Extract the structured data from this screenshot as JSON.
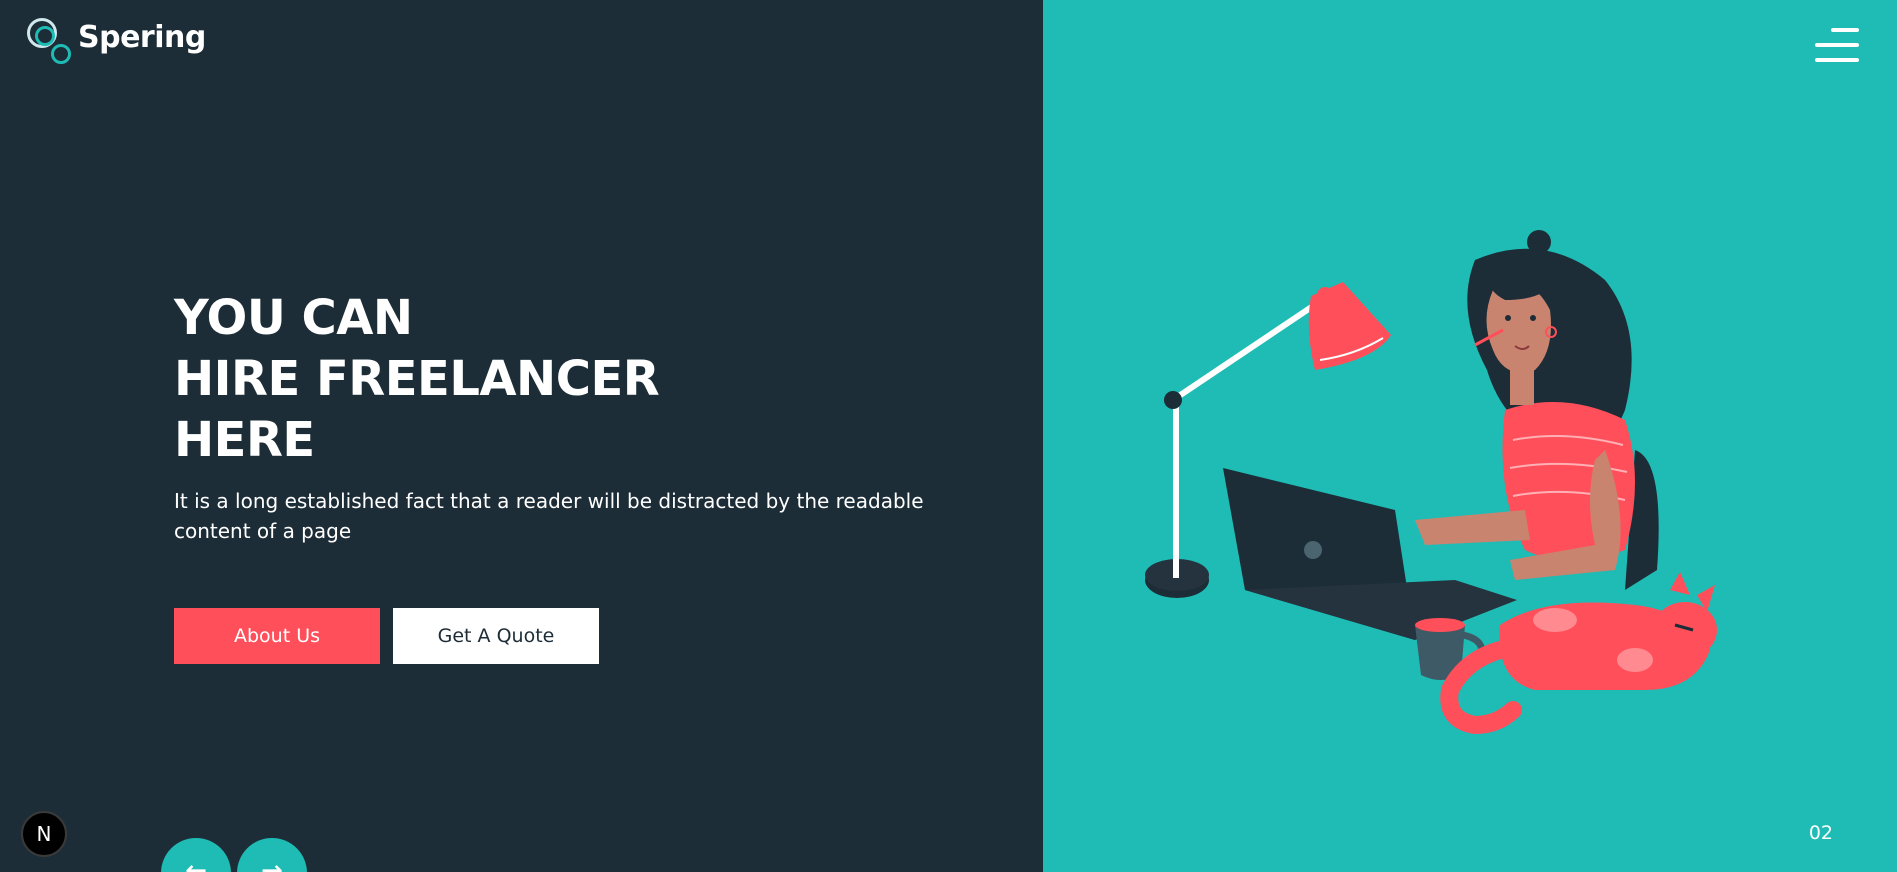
{
  "brand": {
    "name": "Spering"
  },
  "hero": {
    "title_lines": [
      "YOU CAN",
      "HIRE FREELANCER",
      "HERE"
    ],
    "description": "It is a long established fact that a reader will be distracted by the readable content of a page",
    "primary_button": "About Us",
    "secondary_button": "Get A Quote"
  },
  "slider": {
    "current": "02",
    "prev_icon": "arrow-left-icon",
    "next_icon": "arrow-right-icon"
  },
  "badge": {
    "label": "N"
  },
  "icons": {
    "menu": "hamburger-menu-icon",
    "logo": "logo-circles-icon"
  },
  "colors": {
    "dark": "#1d2d37",
    "teal": "#1ebcb5",
    "coral": "#ff4f5a",
    "white": "#ffffff"
  }
}
